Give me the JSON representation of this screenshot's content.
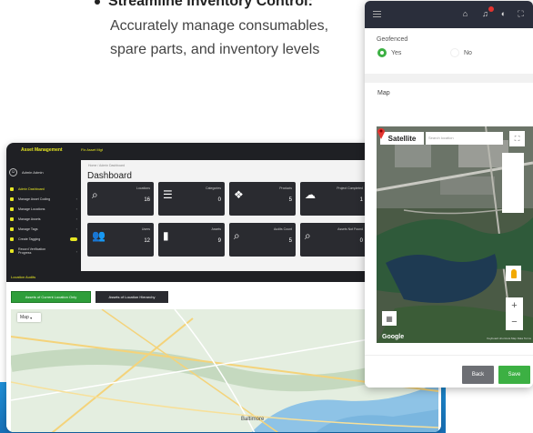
{
  "marketing": {
    "bullet_title": "Streamline Inventory Control:",
    "description": "Accurately manage consumables, spare parts, and inventory levels"
  },
  "desktop": {
    "brand": "Asset Management",
    "top_menu": "Fix Asset Mgt",
    "sidebar": {
      "user": "Admin Admin",
      "items": [
        {
          "label": "Admin Dashboard",
          "active": true
        },
        {
          "label": "Manage Asset Coding",
          "active": false
        },
        {
          "label": "Manage Locations",
          "active": false
        },
        {
          "label": "Manage Assets",
          "active": false
        },
        {
          "label": "Manage Tags",
          "active": false
        },
        {
          "label": "Create Tagging",
          "active": false
        },
        {
          "label": "Record Verification Progress",
          "active": false
        }
      ]
    },
    "breadcrumb": "Home / Admin Dashboard",
    "title": "Dashboard",
    "cards": [
      {
        "label": "Locations",
        "value": "16",
        "icon": "search-icon"
      },
      {
        "label": "Categories",
        "value": "0",
        "icon": "list-icon"
      },
      {
        "label": "Products",
        "value": "5",
        "icon": "dropbox-icon"
      },
      {
        "label": "Project Completed",
        "value": "1",
        "icon": "cloud-icon"
      },
      {
        "label": "Users",
        "value": "12",
        "icon": "users-icon"
      },
      {
        "label": "Assets",
        "value": "9",
        "icon": "clipboard-icon"
      },
      {
        "label": "Audits Count",
        "value": "5",
        "icon": "search-icon"
      },
      {
        "label": "Assets Not Found",
        "value": "0",
        "icon": "search-icon"
      }
    ],
    "location_audits": "Location Audits",
    "btn_current": "Assets of Current Location Only",
    "btn_hierarchy": "Assets of Location Hierarchy",
    "map_label": "Map",
    "city_label": "Baltimore"
  },
  "mobile": {
    "geofenced_label": "Geofenced",
    "yes_label": "Yes",
    "no_label": "No",
    "map_label": "Map",
    "satellite_label": "Satellite",
    "location_placeholder": "Search location",
    "google_label": "Google",
    "attribution": "Keyboard shortcuts  Map Data  Terms",
    "back_label": "Back",
    "save_label": "Save",
    "colors": {
      "accent": "#3cb043",
      "topbar": "#2a2e3b",
      "brand_yellow": "#e6e623"
    }
  }
}
